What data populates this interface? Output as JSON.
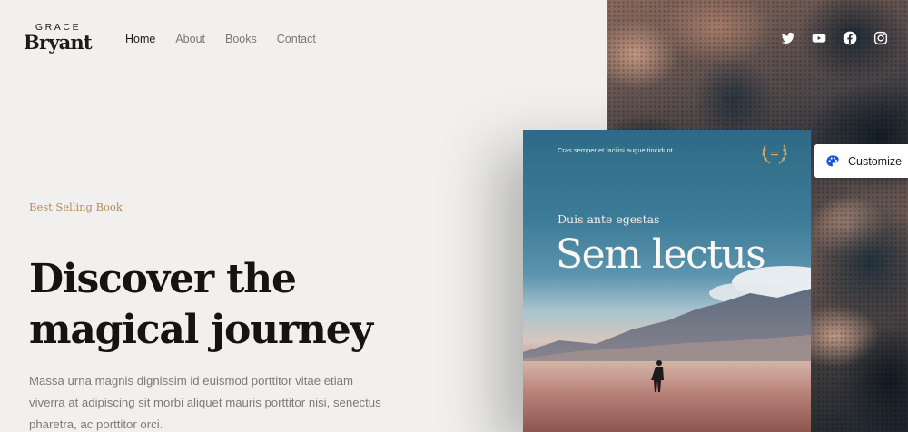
{
  "brand": {
    "logo_top": "GRACE",
    "logo_bottom": "Bryant"
  },
  "nav": {
    "items": [
      {
        "label": "Home",
        "active": true
      },
      {
        "label": "About",
        "active": false
      },
      {
        "label": "Books",
        "active": false
      },
      {
        "label": "Contact",
        "active": false
      }
    ]
  },
  "social": [
    "twitter-icon",
    "youtube-icon",
    "facebook-icon",
    "instagram-icon"
  ],
  "hero": {
    "eyebrow": "Best Selling Book",
    "headline_line1": "Discover the",
    "headline_line2": "magical journey",
    "lead": "Massa urna magnis dignissim id euismod porttitor vitae etiam viverra at adipiscing sit morbi aliquet mauris porttitor nisi, senectus pharetra, ac porttitor orci."
  },
  "book": {
    "top_text": "Cras semper et facilisi augue tincidunt",
    "subtitle": "Duis ante egestas",
    "title": "Sem lectus"
  },
  "customize": {
    "label": "Customize"
  },
  "colors": {
    "background": "#f1f0ef",
    "accent_gold": "#b38c5c",
    "heading": "#161412",
    "body_text": "#7e7b78",
    "customize_icon": "#1a56db"
  }
}
